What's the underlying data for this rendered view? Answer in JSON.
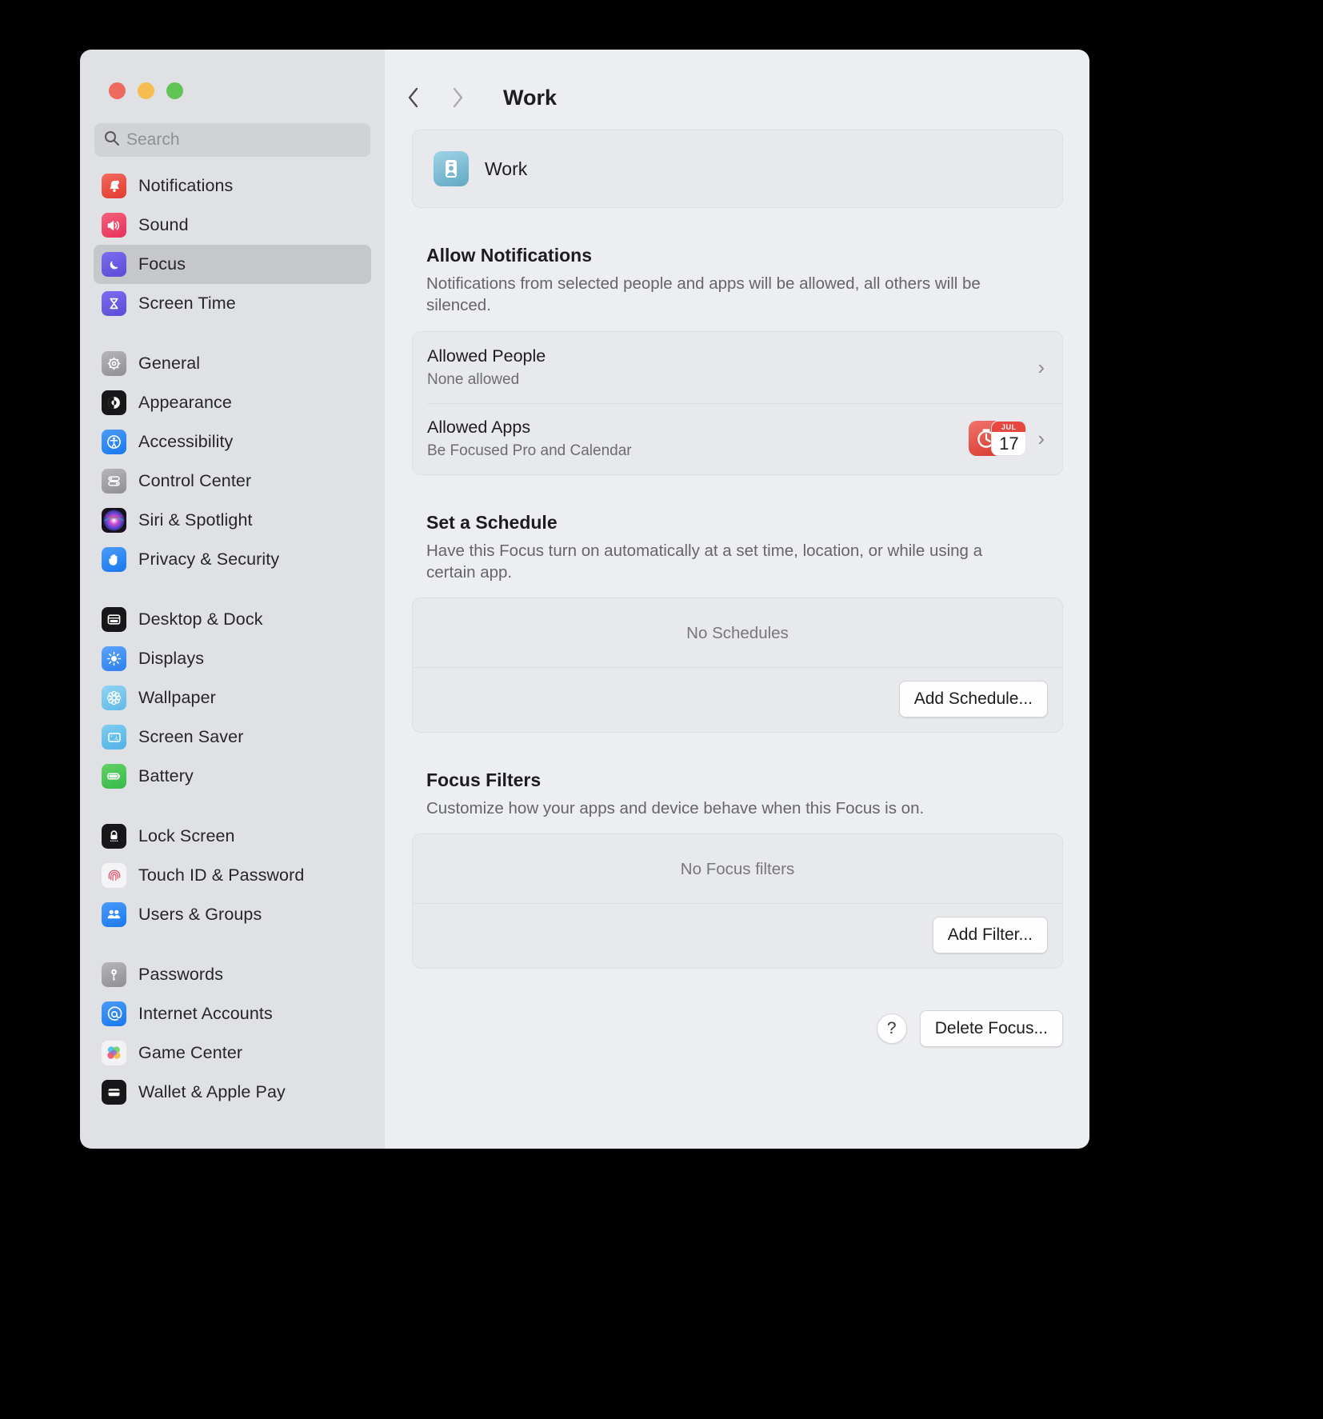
{
  "window": {
    "traffic_lights": [
      "close",
      "minimize",
      "zoom"
    ]
  },
  "search": {
    "placeholder": "Search",
    "value": ""
  },
  "sidebar": {
    "groups": [
      {
        "items": [
          {
            "label": "Notifications",
            "icon": "bell-icon",
            "selected": false
          },
          {
            "label": "Sound",
            "icon": "speaker-icon",
            "selected": false
          },
          {
            "label": "Focus",
            "icon": "moon-icon",
            "selected": true
          },
          {
            "label": "Screen Time",
            "icon": "hourglass-icon",
            "selected": false
          }
        ]
      },
      {
        "items": [
          {
            "label": "General",
            "icon": "gear-icon",
            "selected": false
          },
          {
            "label": "Appearance",
            "icon": "contrast-circle-icon",
            "selected": false
          },
          {
            "label": "Accessibility",
            "icon": "accessibility-icon",
            "selected": false
          },
          {
            "label": "Control Center",
            "icon": "sliders-icon",
            "selected": false
          },
          {
            "label": "Siri & Spotlight",
            "icon": "siri-orb-icon",
            "selected": false
          },
          {
            "label": "Privacy & Security",
            "icon": "hand-icon",
            "selected": false
          }
        ]
      },
      {
        "items": [
          {
            "label": "Desktop & Dock",
            "icon": "desktop-dock-icon",
            "selected": false
          },
          {
            "label": "Displays",
            "icon": "brightness-icon",
            "selected": false
          },
          {
            "label": "Wallpaper",
            "icon": "flower-icon",
            "selected": false
          },
          {
            "label": "Screen Saver",
            "icon": "screensaver-icon",
            "selected": false
          },
          {
            "label": "Battery",
            "icon": "battery-icon",
            "selected": false
          }
        ]
      },
      {
        "items": [
          {
            "label": "Lock Screen",
            "icon": "lock-icon",
            "selected": false
          },
          {
            "label": "Touch ID & Password",
            "icon": "fingerprint-icon",
            "selected": false
          },
          {
            "label": "Users & Groups",
            "icon": "users-icon",
            "selected": false
          }
        ]
      },
      {
        "items": [
          {
            "label": "Passwords",
            "icon": "key-icon",
            "selected": false
          },
          {
            "label": "Internet Accounts",
            "icon": "at-sign-icon",
            "selected": false
          },
          {
            "label": "Game Center",
            "icon": "game-center-icon",
            "selected": false
          },
          {
            "label": "Wallet & Apple Pay",
            "icon": "wallet-icon",
            "selected": false
          }
        ]
      }
    ]
  },
  "toolbar": {
    "back_icon": "chevron-left-icon",
    "forward_icon": "chevron-right-icon",
    "title": "Work"
  },
  "focus_header": {
    "name": "Work",
    "icon": "id-badge-icon"
  },
  "allow_notifications": {
    "title": "Allow Notifications",
    "description": "Notifications from selected people and apps will be allowed, all others will be silenced.",
    "rows": [
      {
        "title": "Allowed People",
        "subtitle": "None allowed",
        "disclosure": "›"
      },
      {
        "title": "Allowed Apps",
        "subtitle": "Be Focused Pro and Calendar",
        "disclosure": "›",
        "app_icons": [
          {
            "name": "be-focused-pro-icon"
          },
          {
            "name": "calendar-icon",
            "month": "JUL",
            "day": "17"
          }
        ]
      }
    ]
  },
  "schedule": {
    "title": "Set a Schedule",
    "description": "Have this Focus turn on automatically at a set time, location, or while using a certain app.",
    "empty_label": "No Schedules",
    "add_button": "Add Schedule..."
  },
  "focus_filters": {
    "title": "Focus Filters",
    "description": "Customize how your apps and device behave when this Focus is on.",
    "empty_label": "No Focus filters",
    "add_button": "Add Filter..."
  },
  "footer": {
    "help_label": "?",
    "delete_button": "Delete Focus..."
  },
  "colors": {
    "sidebar_bg": "#dfe1e5",
    "content_bg": "#eceef1",
    "selected_row": "#c5c7cb",
    "accent_blue": "#3478f6"
  }
}
